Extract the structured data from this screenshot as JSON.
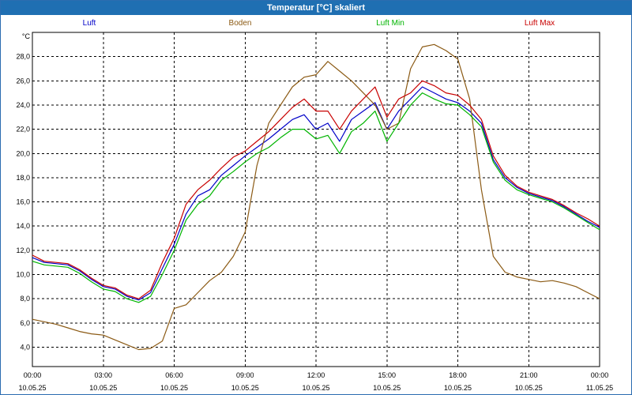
{
  "window": {
    "title": "Temperatur [°C] skaliert"
  },
  "chart_data": {
    "type": "line",
    "title": "Temperatur [°C] skaliert",
    "ylabel": "°C",
    "ylim": [
      2.4,
      30.0
    ],
    "xlim_hours": [
      0,
      24
    ],
    "grid": true,
    "legend_placement": "top",
    "y_ticks": [
      "4,0",
      "6,0",
      "8,0",
      "10,0",
      "12,0",
      "14,0",
      "16,0",
      "18,0",
      "20,0",
      "22,0",
      "24,0",
      "26,0",
      "28,0"
    ],
    "x_ticks": [
      {
        "time": "00:00",
        "date": "10.05.25"
      },
      {
        "time": "03:00",
        "date": "10.05.25"
      },
      {
        "time": "06:00",
        "date": "10.05.25"
      },
      {
        "time": "09:00",
        "date": "10.05.25"
      },
      {
        "time": "12:00",
        "date": "10.05.25"
      },
      {
        "time": "15:00",
        "date": "10.05.25"
      },
      {
        "time": "18:00",
        "date": "10.05.25"
      },
      {
        "time": "21:00",
        "date": "10.05.25"
      },
      {
        "time": "00:00",
        "date": "11.05.25"
      }
    ],
    "x_hours": [
      0,
      0.5,
      1,
      1.5,
      2,
      2.5,
      3,
      3.5,
      4,
      4.5,
      5,
      5.5,
      6,
      6.5,
      7,
      7.5,
      8,
      8.5,
      9,
      9.5,
      10,
      10.5,
      11,
      11.5,
      12,
      12.5,
      13,
      13.5,
      14,
      14.5,
      15,
      15.5,
      16,
      16.5,
      17,
      17.5,
      18,
      18.5,
      19,
      19.5,
      20,
      20.5,
      21,
      21.5,
      22,
      22.5,
      23,
      23.5,
      24
    ],
    "series": [
      {
        "name": "Luft",
        "color": "#0000c8",
        "values": [
          11.4,
          11.0,
          10.9,
          10.8,
          10.3,
          9.6,
          9.0,
          8.8,
          8.2,
          7.9,
          8.5,
          10.5,
          12.5,
          15.0,
          16.5,
          17.0,
          18.2,
          19.0,
          19.8,
          20.5,
          21.2,
          22.0,
          22.8,
          23.2,
          22.0,
          22.5,
          21.0,
          22.8,
          23.5,
          24.2,
          22.0,
          23.5,
          24.5,
          25.5,
          25.0,
          24.5,
          24.2,
          23.5,
          22.5,
          19.5,
          18.0,
          17.2,
          16.7,
          16.4,
          16.1,
          15.6,
          15.0,
          14.4,
          13.9
        ]
      },
      {
        "name": "Boden",
        "color": "#8b5a14",
        "values": [
          6.3,
          6.1,
          5.9,
          5.6,
          5.3,
          5.1,
          5.0,
          4.6,
          4.2,
          3.8,
          3.9,
          4.5,
          7.2,
          7.5,
          8.5,
          9.5,
          10.2,
          11.5,
          13.5,
          19.0,
          22.5,
          24.0,
          25.5,
          26.3,
          26.5,
          27.6,
          26.8,
          26.0,
          25.0,
          24.0,
          22.0,
          22.5,
          27.0,
          28.8,
          29.0,
          28.5,
          27.8,
          24.5,
          17.0,
          11.5,
          10.2,
          9.8,
          9.6,
          9.4,
          9.5,
          9.3,
          9.0,
          8.5,
          8.0
        ]
      },
      {
        "name": "Luft Min",
        "color": "#00b400",
        "values": [
          11.1,
          10.8,
          10.7,
          10.6,
          10.1,
          9.4,
          8.8,
          8.6,
          8.0,
          7.7,
          8.2,
          10.0,
          12.0,
          14.5,
          15.8,
          16.5,
          17.8,
          18.5,
          19.3,
          20.0,
          20.5,
          21.3,
          22.0,
          22.0,
          21.2,
          21.5,
          20.0,
          21.8,
          22.5,
          23.5,
          21.0,
          22.5,
          24.0,
          25.0,
          24.5,
          24.1,
          24.0,
          23.2,
          22.2,
          19.3,
          17.8,
          17.0,
          16.6,
          16.3,
          16.0,
          15.5,
          14.9,
          14.3,
          13.7
        ]
      },
      {
        "name": "Luft Max",
        "color": "#c80000",
        "values": [
          11.6,
          11.1,
          11.0,
          10.9,
          10.4,
          9.7,
          9.1,
          8.9,
          8.3,
          8.0,
          8.7,
          11.0,
          13.0,
          15.8,
          17.0,
          17.8,
          18.8,
          19.7,
          20.2,
          21.0,
          21.8,
          22.8,
          23.8,
          24.5,
          23.5,
          23.5,
          22.0,
          23.5,
          24.5,
          25.5,
          23.0,
          24.5,
          25.0,
          26.0,
          25.6,
          25.0,
          24.8,
          24.0,
          22.8,
          19.8,
          18.2,
          17.3,
          16.8,
          16.5,
          16.2,
          15.7,
          15.1,
          14.6,
          14.0
        ]
      }
    ]
  }
}
